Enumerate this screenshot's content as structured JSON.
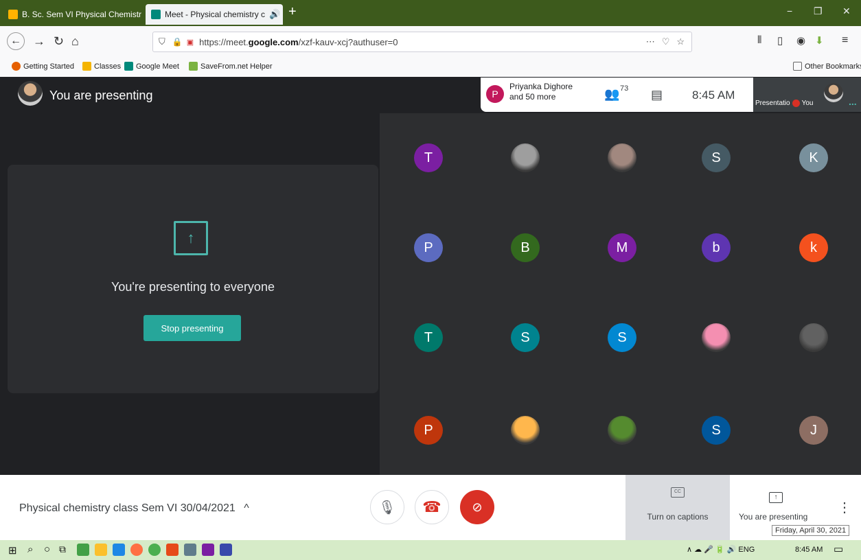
{
  "browser": {
    "tabs": [
      {
        "label": "B. Sc. Sem VI Physical Chemistr",
        "close": "✕"
      },
      {
        "label": "Meet - Physical chemistry c",
        "close": "✕",
        "audio": "🔊"
      }
    ],
    "new_tab": "+",
    "window_controls": {
      "minimize": "−",
      "restore": "❐",
      "close": "✕"
    },
    "url_prefix": "https://meet.",
    "url_domain": "google.com",
    "url_path": "/xzf-kauv-xcj?authuser=0",
    "url_more": "⋯",
    "bookmarks": [
      {
        "label": "Getting Started",
        "color": "#e66000"
      },
      {
        "label": "Classes",
        "color": "#f4b400"
      },
      {
        "label": "Google Meet",
        "color": "#00897b"
      },
      {
        "label": "SaveFrom.net Helper",
        "color": "#7cb342"
      }
    ],
    "other_bookmarks": "Other Bookmarks"
  },
  "meet": {
    "presenting_label": "You are presenting",
    "pill": {
      "initial": "P",
      "line1": "Priyanka Dighore",
      "line2": "and 50 more"
    },
    "participant_count": "73",
    "time": "8:45 AM",
    "thumb_label1": "Presentatio",
    "thumb_label2": "You",
    "thumb_more": "...",
    "present_card": {
      "heading": "You're presenting to everyone",
      "stop_button": "Stop presenting"
    },
    "tiles": [
      {
        "initial": "T",
        "color": "#7b1fa2"
      },
      {
        "photo": true,
        "color": "#9e9e9e"
      },
      {
        "photo": true,
        "color": "#a1887f"
      },
      {
        "initial": "S",
        "color": "#455a64"
      },
      {
        "initial": "K",
        "color": "#78909c"
      },
      {
        "initial": "P",
        "color": "#5c6bc0"
      },
      {
        "initial": "B",
        "color": "#33691e"
      },
      {
        "initial": "M",
        "color": "#7b1fa2"
      },
      {
        "initial": "b",
        "color": "#5e35b1"
      },
      {
        "initial": "k",
        "color": "#f4511e"
      },
      {
        "initial": "T",
        "color": "#00796b"
      },
      {
        "initial": "S",
        "color": "#00838f"
      },
      {
        "initial": "S",
        "color": "#0288d1"
      },
      {
        "photo": true,
        "color": "#f48fb1"
      },
      {
        "photo": true,
        "color": "#616161"
      },
      {
        "initial": "P",
        "color": "#bf360c"
      },
      {
        "photo": true,
        "color": "#ffb74d"
      },
      {
        "photo": true,
        "color": "#558b2f"
      },
      {
        "initial": "S",
        "color": "#01579b"
      },
      {
        "initial": "J",
        "color": "#8d6e63"
      }
    ]
  },
  "bottombar": {
    "meeting_title": "Physical chemistry class Sem VI 30/04/2021",
    "caret": "^",
    "captions_label": "Turn on captions",
    "present_label": "You are presenting",
    "more": "⋮",
    "tooltip": "Friday, April 30, 2021"
  },
  "taskbar": {
    "tray": "∧ ☁ 🎤 🔋 🔊 ENG",
    "time": "8:45 AM"
  },
  "colors": {
    "accent": "#4db6ac",
    "end_call": "#d93025",
    "stop_button": "#26a69a"
  }
}
